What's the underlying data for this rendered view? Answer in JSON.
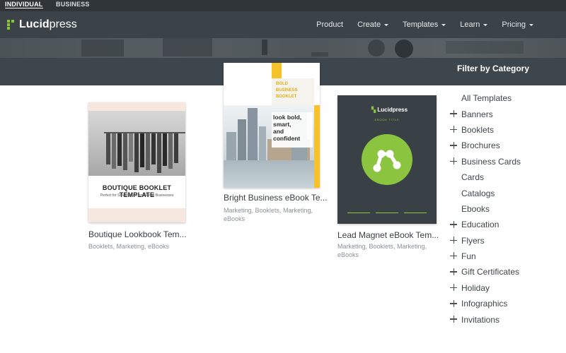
{
  "top_tabs": {
    "individual": "INDIVIDUAL",
    "business": "BUSINESS"
  },
  "brand": {
    "name_bold": "Lucid",
    "name_rest": "press",
    "accent": "#8bc53f"
  },
  "nav": {
    "items": [
      {
        "label": "Product",
        "has_caret": false
      },
      {
        "label": "Create",
        "has_caret": true
      },
      {
        "label": "Templates",
        "has_caret": true
      },
      {
        "label": "Learn",
        "has_caret": true
      },
      {
        "label": "Pricing",
        "has_caret": true
      }
    ]
  },
  "hero": {
    "filter_title": "Filter by Category"
  },
  "templates": [
    {
      "title": "Boutique Lookbook Tem...",
      "tags": "Booklets, Marketing, eBooks",
      "cover_title": "BOUTIQUE BOOKLET TEMPLATE",
      "cover_subtitle": "Perfect for Small Online and Retail Businesses"
    },
    {
      "title": "Bright Business eBook Te...",
      "tags": "Marketing, Booklets, Marketing, eBooks",
      "cover_heading": [
        "BOLD",
        "BUSINESS",
        "BOOKLET"
      ],
      "cover_tagline": [
        "look bold,",
        "smart,",
        "and",
        "confident"
      ]
    },
    {
      "title": "Lead Magnet eBook Tem...",
      "tags": "Marketing, Booklets, Marketing, eBooks",
      "cover_logo": "Lucidpress",
      "cover_subtitle": "EBOOK TITLE"
    }
  ],
  "categories": [
    {
      "label": "All Templates",
      "expandable": false
    },
    {
      "label": "Banners",
      "expandable": true
    },
    {
      "label": "Booklets",
      "expandable": true
    },
    {
      "label": "Brochures",
      "expandable": true
    },
    {
      "label": "Business Cards",
      "expandable": true
    },
    {
      "label": "Cards",
      "expandable": false
    },
    {
      "label": "Catalogs",
      "expandable": false
    },
    {
      "label": "Ebooks",
      "expandable": false
    },
    {
      "label": "Education",
      "expandable": true
    },
    {
      "label": "Flyers",
      "expandable": true
    },
    {
      "label": "Fun",
      "expandable": true
    },
    {
      "label": "Gift Certificates",
      "expandable": true
    },
    {
      "label": "Holiday",
      "expandable": true
    },
    {
      "label": "Infographics",
      "expandable": true
    },
    {
      "label": "Invitations",
      "expandable": true
    }
  ]
}
